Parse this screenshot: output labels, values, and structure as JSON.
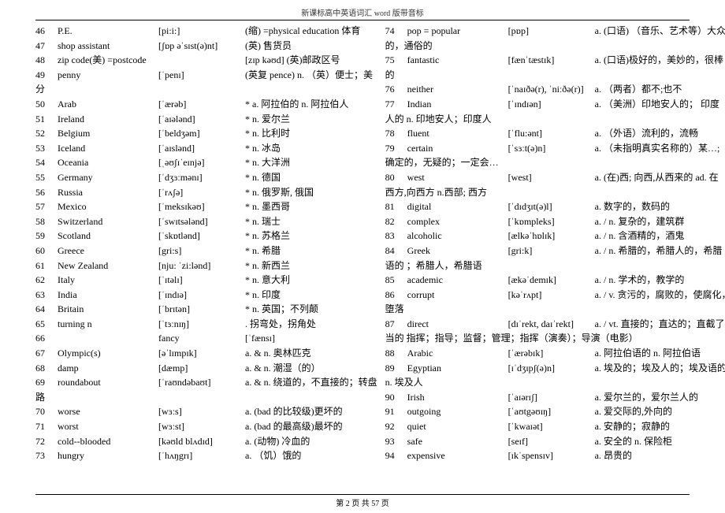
{
  "header": "新课标高中英语词汇 word 版带音标",
  "footer": "第 2 页 共 57 页",
  "left": [
    {
      "n": "46",
      "w": "P.E.",
      "p": "[pi:i:]",
      "d": "(缩) =physical education 体育"
    },
    {
      "n": "47",
      "w": "shop assistant",
      "p": "[ʃɒp əˈsɪst(ə)nt]",
      "d": "(英) 售货员"
    },
    {
      "n": "48",
      "w": "zip code(美) =postcode",
      "p": "",
      "d": "[zɪp kəʊd]  (英)邮政区号"
    },
    {
      "n": "49",
      "w": "penny",
      "p": "[ˈpenɪ]",
      "d": "(英复 pence) n. （英）便士；美"
    },
    {
      "n": "",
      "w": "分",
      "p": "",
      "d": "",
      "cont": true
    },
    {
      "n": "50",
      "w": "Arab",
      "p": "[ˈærəb]",
      "d": "* a. 阿拉伯的  n. 阿拉伯人"
    },
    {
      "n": "51",
      "w": "Ireland",
      "p": "[ˈaɪələnd]",
      "d": "* n. 爱尔兰"
    },
    {
      "n": "52",
      "w": "Belgium",
      "p": "[ˈbeldʒəm]",
      "d": "* n. 比利时"
    },
    {
      "n": "53",
      "w": "Iceland",
      "p": "[ˈaɪslənd]",
      "d": "* n. 冰岛"
    },
    {
      "n": "54",
      "w": "Oceania",
      "p": "[ˌəʊʃɪˈeɪnjə]",
      "d": "* n. 大洋洲"
    },
    {
      "n": "55",
      "w": "Germany",
      "p": "[ˈdʒɜːmənɪ]",
      "d": "* n. 德国"
    },
    {
      "n": "56",
      "w": "Russia",
      "p": "[ˈrʌʃə]",
      "d": "* n. 俄罗斯, 俄国"
    },
    {
      "n": "57",
      "w": "Mexico",
      "p": "[ˈmeksɪkəʊ]",
      "d": "* n. 墨西哥"
    },
    {
      "n": "58",
      "w": "Switzerland",
      "p": "[ˈswɪtsələnd]",
      "d": "* n. 瑞士"
    },
    {
      "n": "59",
      "w": "Scotland",
      "p": "[ˈskɒtlənd]",
      "d": "* n. 苏格兰"
    },
    {
      "n": "60",
      "w": "Greece",
      "p": "[gri:s]",
      "d": "* n. 希腊"
    },
    {
      "n": "61",
      "w": "New Zealand",
      "p": "[nju: ˈzi:lənd]",
      "d": "* n. 新西兰"
    },
    {
      "n": "62",
      "w": "Italy",
      "p": "[ˈɪtəlɪ]",
      "d": "* n. 意大利"
    },
    {
      "n": "63",
      "w": "India",
      "p": "[ˈɪndɪə]",
      "d": "* n. 印度"
    },
    {
      "n": "64",
      "w": "Britain",
      "p": "[ˈbrɪtən]",
      "d": "* n. 英国；不列颠"
    },
    {
      "n": "65",
      "w": "turning n",
      "p": "[ˈtɜːnɪŋ]",
      "d": ". 拐弯处，拐角处"
    },
    {
      "n": "66",
      "w": "",
      "p": "fancy",
      "d": "[ˈfænsɪ]"
    },
    {
      "n": "67",
      "w": "Olympic(s)",
      "p": "[əˈlɪmpɪk]",
      "d": "a. & n. 奥林匹克"
    },
    {
      "n": "68",
      "w": "damp",
      "p": "[dæmp]",
      "d": "a. & n. 潮湿（的）"
    },
    {
      "n": "69",
      "w": "roundabout",
      "p": "[ˈraʊndəbaʊt]",
      "d": "a. & n. 绕道的，不直接的；转盘"
    },
    {
      "n": "",
      "w": "路",
      "p": "",
      "d": "",
      "cont": true
    },
    {
      "n": "70",
      "w": "worse",
      "p": "[wɜːs]",
      "d": "a. (bad 的比较级)更坏的"
    },
    {
      "n": "71",
      "w": "worst",
      "p": "[wɜːst]",
      "d": "a. (bad 的最高级)最坏的"
    },
    {
      "n": "72",
      "w": "cold--blooded",
      "p": "[kəʊld blʌdɪd]",
      "d": "a. (动物) 冷血的"
    },
    {
      "n": "73",
      "w": "hungry",
      "p": "[ˈhʌŋgrɪ]",
      "d": "a. （饥）饿的"
    }
  ],
  "right": [
    {
      "n": "74",
      "w": "pop = popular",
      "p": "[pɒp]",
      "d": "a. (口语) （音乐、艺术等）大众"
    },
    {
      "n": "",
      "w": "的，通俗的",
      "p": "",
      "d": "",
      "cont": true
    },
    {
      "n": "75",
      "w": "fantastic",
      "p": "[fænˈtæstɪk]",
      "d": "a. (口语)极好的，美妙的，很棒"
    },
    {
      "n": "",
      "w": "的",
      "p": "",
      "d": "",
      "cont": true
    },
    {
      "n": "76",
      "w": "neither",
      "p": "[ˈnaɪðə(r), ˈniːðə(r)]",
      "d": "a. （两者）都不;也不"
    },
    {
      "n": "77",
      "w": "Indian",
      "p": "[ˈɪndɪən]",
      "d": "a. （美洲）印地安人的； 印度"
    },
    {
      "n": "",
      "w": "人的  n. 印地安人；印度人",
      "p": "",
      "d": "",
      "cont": true
    },
    {
      "n": "78",
      "w": "fluent",
      "p": "[ˈflu:ənt]",
      "d": "a. （外语）流利的，流畅"
    },
    {
      "n": "79",
      "w": "certain",
      "p": "[ˈsɜːt(ə)n]",
      "d": "a. （未指明真实名称的）某…;"
    },
    {
      "n": "",
      "w": "确定的，无疑的；一定会…",
      "p": "",
      "d": "",
      "cont": true
    },
    {
      "n": "80",
      "w": "west",
      "p": "[west]",
      "d": "a. (在)西;  向西,从西来的  ad. 在"
    },
    {
      "n": "",
      "w": "西方,向西方 n.西部; 西方",
      "p": "",
      "d": "",
      "cont": true
    },
    {
      "n": "81",
      "w": "digital",
      "p": "[ˈdɪdʒɪt(ə)l]",
      "d": "a. 数字的，数码的"
    },
    {
      "n": "82",
      "w": "complex",
      "p": "[ˈkɒmpleks]",
      "d": "a. / n.  复杂的，建筑群"
    },
    {
      "n": "83",
      "w": "alcoholic",
      "p": "[ælkəˈhɒlɪk]",
      "d": "a. / n. 含酒精的，酒鬼"
    },
    {
      "n": "84",
      "w": "Greek",
      "p": "[gri:k]",
      "d": "a. / n. 希腊的，希腊人的，希腊"
    },
    {
      "n": "",
      "w": "语的 ；希腊人，希腊语",
      "p": "",
      "d": "",
      "cont": true
    },
    {
      "n": "85",
      "w": "academic",
      "p": "[ækəˈdemɪk]",
      "d": "a. / n. 学术的，教学的"
    },
    {
      "n": "86",
      "w": "corrupt",
      "p": "[kəˈrʌpt]",
      "d": "a. / v. 贪污的，腐败的，使腐化，"
    },
    {
      "n": "",
      "w": "堕落",
      "p": "",
      "d": "",
      "cont": true
    },
    {
      "n": "87",
      "w": "direct",
      "p": "[dɪˈrekt, daɪˈrekt]",
      "d": "a. / vt. 直接的；直达的；直截了"
    },
    {
      "n": "",
      "w": "当的 指挥；指导；监督；管理；指挥（演奏）；导演（电影）",
      "p": "",
      "d": "",
      "cont": true
    },
    {
      "n": "88",
      "w": "Arabic",
      "p": "[ˈærəbɪk]",
      "d": "a. 阿拉伯语的  n. 阿拉伯语"
    },
    {
      "n": "89",
      "w": "Egyptian",
      "p": "[ɪˈdʒɪpʃ(ə)n]",
      "d": "a. 埃及的；埃及人的；埃及语的"
    },
    {
      "n": "",
      "w": "n. 埃及人",
      "p": "",
      "d": "",
      "cont": true
    },
    {
      "n": "90",
      "w": "Irish",
      "p": "[ˈaɪərɪʃ]",
      "d": "a. 爱尔兰的，爱尔兰人的"
    },
    {
      "n": "91",
      "w": "outgoing",
      "p": "[ˈaʊtgəʊɪŋ]",
      "d": "a. 爱交际的,外向的"
    },
    {
      "n": "92",
      "w": "quiet",
      "p": "[ˈkwaɪət]",
      "d": "a. 安静的；寂静的"
    },
    {
      "n": "93",
      "w": "safe",
      "p": "[seɪf]",
      "d": "a. 安全的  n. 保险柜"
    },
    {
      "n": "94",
      "w": "expensive",
      "p": "[ɪkˈspensɪv]",
      "d": "a. 昂贵的"
    }
  ]
}
